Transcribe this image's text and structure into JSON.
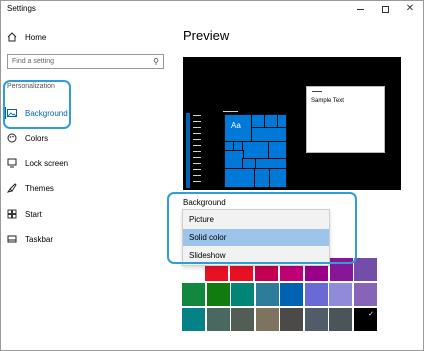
{
  "window": {
    "title": "Settings",
    "controls": [
      "minimize",
      "maximize",
      "close"
    ]
  },
  "sidebar": {
    "home_label": "Home",
    "search_placeholder": "Find a setting",
    "section_label": "Personalization",
    "items": [
      {
        "label": "Background",
        "icon": "picture-icon",
        "selected": true
      },
      {
        "label": "Colors",
        "icon": "palette-icon",
        "selected": false
      },
      {
        "label": "Lock screen",
        "icon": "lock-screen-icon",
        "selected": false
      },
      {
        "label": "Themes",
        "icon": "brush-icon",
        "selected": false
      },
      {
        "label": "Start",
        "icon": "start-grid-icon",
        "selected": false
      },
      {
        "label": "Taskbar",
        "icon": "taskbar-icon",
        "selected": false
      }
    ]
  },
  "main": {
    "preview_title": "Preview",
    "preview": {
      "sample_text": "Sample Text",
      "tile_text": "Aa",
      "accent_color": "#0078d7"
    },
    "background_label": "Background",
    "dropdown": {
      "options": [
        "Picture",
        "Solid color",
        "Slideshow"
      ],
      "selected": "Solid color"
    },
    "swatches": [
      [
        "#e81123",
        "#e81123",
        "#c30052",
        "#bf0077",
        "#9a0089",
        "#881798",
        "#744da9"
      ],
      [
        "#10893e",
        "#107c10",
        "#018574",
        "#2d7d9a",
        "#0063b1",
        "#6b69d6",
        "#8e8cd8",
        "#8764b8"
      ],
      [
        "#038387",
        "#486860",
        "#525e54",
        "#7e735f",
        "#4c4a48",
        "#515c6b",
        "#4a5459",
        "#000000"
      ]
    ],
    "selected_swatch": "#000000"
  },
  "colors": {
    "accent": "#0063b1",
    "highlight_outline": "#2d9fd6"
  }
}
